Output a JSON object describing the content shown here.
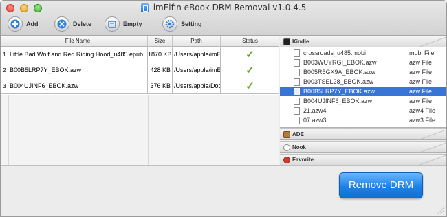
{
  "window": {
    "title": "imElfin eBook DRM Removal v1.0.4.5"
  },
  "toolbar": {
    "add_label": "Add",
    "delete_label": "Delete",
    "empty_label": "Empty",
    "setting_label": "Setting"
  },
  "table": {
    "columns": {
      "name": "File Name",
      "size": "Size",
      "path": "Path",
      "status": "Status"
    },
    "rows": [
      {
        "index": "1",
        "name": "Little Bad Wolf and Red Riding Hood_u485.epub",
        "size": "1870 KB",
        "path": "/Users/apple/imE",
        "status": "✓"
      },
      {
        "index": "2",
        "name": "B00B5LRP7Y_EBOK.azw",
        "size": "428 KB",
        "path": "/Users/apple/imE",
        "status": "✓"
      },
      {
        "index": "3",
        "name": "B004UJINF6_EBOK.azw",
        "size": "376 KB",
        "path": "/Users/apple/Doc",
        "status": "✓"
      }
    ]
  },
  "sidebar": {
    "kindle_label": "Kindle",
    "ade_label": "ADE",
    "nook_label": "Nook",
    "favorite_label": "Favorite",
    "files": [
      {
        "name": "crossroads_u485.mobi",
        "type": "mobi File"
      },
      {
        "name": "B003WUYRGI_EBOK.azw",
        "type": "azw File"
      },
      {
        "name": "B005R5GX9A_EBOK.azw",
        "type": "azw File"
      },
      {
        "name": "B003TSEL28_EBOK.azw",
        "type": "azw File"
      },
      {
        "name": "B00B5LRP7Y_EBOK.azw",
        "type": "azw File"
      },
      {
        "name": "B004UJINF6_EBOK.azw",
        "type": "azw File"
      },
      {
        "name": "21.azw4",
        "type": "azw4 File"
      },
      {
        "name": "07.azw3",
        "type": "azw3 File"
      }
    ],
    "selected_index": 4
  },
  "actions": {
    "remove_drm_label": "Remove DRM"
  },
  "colors": {
    "selection": "#3875d7",
    "accent": "#1e82e6",
    "check": "#5aa81c"
  }
}
